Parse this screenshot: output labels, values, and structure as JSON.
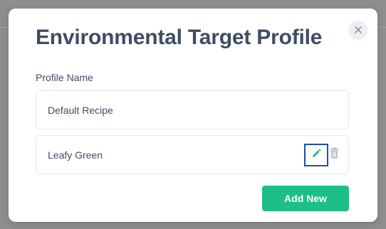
{
  "modal": {
    "title": "Environmental Target Profile",
    "close_icon": "close-icon",
    "section_label": "Profile Name",
    "profiles": [
      {
        "name": "Default Recipe"
      },
      {
        "name": "Leafy Green",
        "edit_icon": "pencil-icon",
        "delete_icon": "trash-icon"
      }
    ],
    "add_button_label": "Add New"
  },
  "colors": {
    "title": "#3e4d63",
    "accent_green": "#1ebe87",
    "focus_outline": "#1d4fa8",
    "icon_gray": "#b5bcc6",
    "backdrop": "#8e8e8e"
  }
}
